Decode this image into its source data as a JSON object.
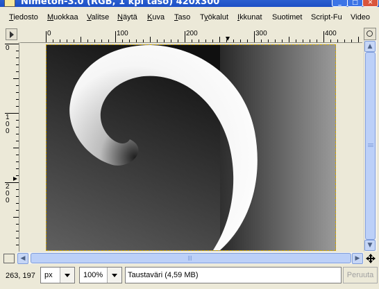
{
  "window": {
    "title": "Nimetön-3.0 (RGB, 1 kpl taso) 420x300"
  },
  "menubar": {
    "items": [
      {
        "label": "Tiedosto",
        "mnemonic_index": 0
      },
      {
        "label": "Muokkaa",
        "mnemonic_index": 0
      },
      {
        "label": "Valitse",
        "mnemonic_index": 0
      },
      {
        "label": "Näytä",
        "mnemonic_index": 0
      },
      {
        "label": "Kuva",
        "mnemonic_index": 0
      },
      {
        "label": "Taso",
        "mnemonic_index": 0
      },
      {
        "label": "Työkalut",
        "mnemonic_index": 1
      },
      {
        "label": "Ikkunat",
        "mnemonic_index": 0
      },
      {
        "label": "Suotimet",
        "mnemonic_index": -1
      },
      {
        "label": "Script-Fu",
        "mnemonic_index": -1
      },
      {
        "label": "Video",
        "mnemonic_index": -1
      }
    ]
  },
  "rulers": {
    "horizontal_labels": [
      "0",
      "100",
      "200",
      "300",
      "400"
    ],
    "vertical_labels": [
      "0",
      "100",
      "200"
    ]
  },
  "statusbar": {
    "pointer_coords": "263, 197",
    "unit": "px",
    "zoom": "100%",
    "message": "Taustaväri (4,59 MB)",
    "cancel_label": "Peruuta"
  },
  "colors": {
    "titlebar": "#1c4fc6",
    "chrome": "#ece9d8",
    "scrollbar_thumb": "#bcd0f8",
    "selection_border": "#c8a000"
  }
}
